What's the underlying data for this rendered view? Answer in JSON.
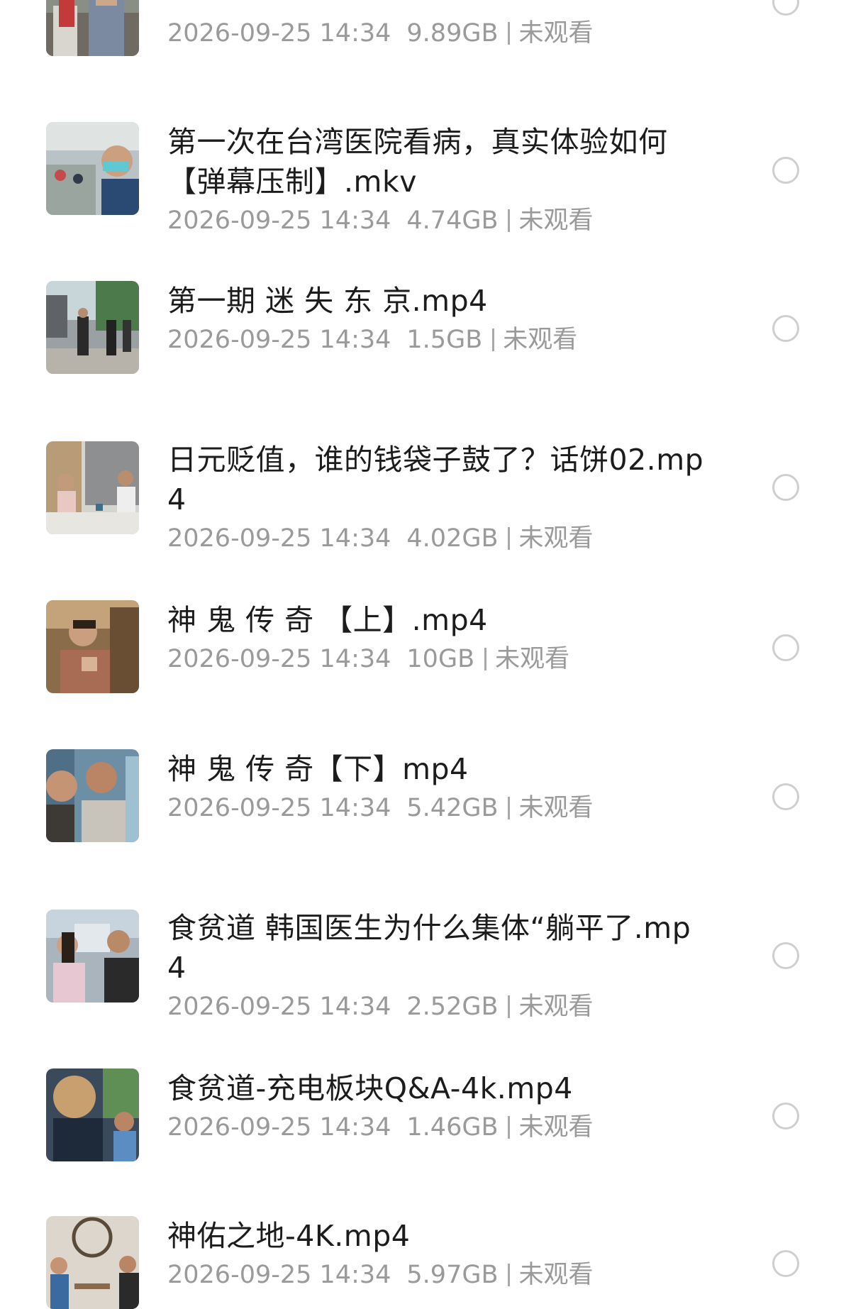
{
  "files": [
    {
      "name": "",
      "date": "2026-09-25 14:34",
      "size": "9.89GB",
      "status": "未观看"
    },
    {
      "name": "第一次在台湾医院看病，真实体验如何【弹幕压制】.mkv",
      "date": "2026-09-25 14:34",
      "size": "4.74GB",
      "status": "未观看"
    },
    {
      "name": "第一期 迷 失 东 京.mp4",
      "date": "2026-09-25 14:34",
      "size": "1.5GB",
      "status": "未观看"
    },
    {
      "name": "日元贬值，谁的钱袋子鼓了？话饼02.mp4",
      "date": "2026-09-25 14:34",
      "size": "4.02GB",
      "status": "未观看"
    },
    {
      "name": "神 鬼 传 奇 【上】.mp4",
      "date": "2026-09-25 14:34",
      "size": "10GB",
      "status": "未观看"
    },
    {
      "name": "神 鬼 传 奇【下】mp4",
      "date": "2026-09-25 14:34",
      "size": "5.42GB",
      "status": "未观看"
    },
    {
      "name": "食贫道 韩国医生为什么集体“躺平了.mp4",
      "date": "2026-09-25 14:34",
      "size": "2.52GB",
      "status": "未观看"
    },
    {
      "name": "食贫道-充电板块Q&A-4k.mp4",
      "date": "2026-09-25 14:34",
      "size": "1.46GB",
      "status": "未观看"
    },
    {
      "name": "神佑之地-4K.mp4",
      "date": "2026-09-25 14:34",
      "size": "5.97GB",
      "status": "未观看"
    }
  ]
}
